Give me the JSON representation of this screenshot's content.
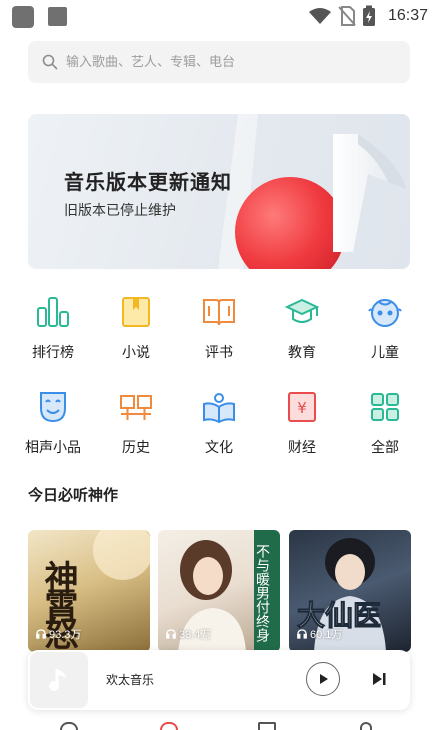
{
  "status_bar": {
    "time": "16:37"
  },
  "search": {
    "placeholder": "输入歌曲、艺人、专辑、电台"
  },
  "banner": {
    "title": "音乐版本更新通知",
    "subtitle": "旧版本已停止维护"
  },
  "categories": [
    {
      "label": "排行榜",
      "icon": "chart-bars-icon",
      "color": "#2bb894"
    },
    {
      "label": "小说",
      "icon": "book-icon",
      "color": "#f2b824"
    },
    {
      "label": "评书",
      "icon": "open-book-icon",
      "color": "#f08a3c"
    },
    {
      "label": "教育",
      "icon": "graduation-cap-icon",
      "color": "#2bb894"
    },
    {
      "label": "儿童",
      "icon": "child-face-icon",
      "color": "#3b8ee8"
    },
    {
      "label": "相声小品",
      "icon": "mask-icon",
      "color": "#3b8ee8"
    },
    {
      "label": "历史",
      "icon": "history-icon",
      "color": "#f08a3c"
    },
    {
      "label": "文化",
      "icon": "culture-book-icon",
      "color": "#3b8ee8"
    },
    {
      "label": "财经",
      "icon": "yen-icon",
      "color": "#e84c4c"
    },
    {
      "label": "全部",
      "icon": "grid-icon",
      "color": "#2bb894"
    }
  ],
  "section": {
    "title": "今日必听神作"
  },
  "cards": [
    {
      "plays": "93.3万",
      "cover_text": "神霄怒"
    },
    {
      "plays": "33.4万",
      "cover_text": "不与暖男付终身"
    },
    {
      "plays": "60.1万",
      "cover_text": "大仙医"
    }
  ],
  "player": {
    "title": "欢太音乐"
  },
  "colors": {
    "accent": "#e84c4c",
    "teal": "#2bb894",
    "blue": "#3b8ee8",
    "orange": "#f08a3c",
    "yellow": "#f2b824"
  }
}
